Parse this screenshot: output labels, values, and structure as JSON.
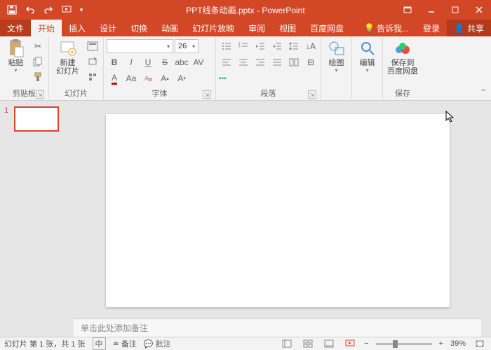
{
  "title": "PPT线条动画.pptx - PowerPoint",
  "qat": {
    "save": "保存",
    "undo": "撤销",
    "redo": "重做",
    "start": "从头开始"
  },
  "tabs": {
    "file": "文件",
    "home": "开始",
    "insert": "插入",
    "design": "设计",
    "transitions": "切换",
    "animations": "动画",
    "slideshow": "幻灯片放映",
    "review": "审阅",
    "view": "视图",
    "baidu": "百度网盘",
    "tell_me": "告诉我...",
    "login": "登录",
    "share": "共享"
  },
  "ribbon": {
    "clipboard": {
      "label": "剪贴板",
      "paste": "粘贴"
    },
    "slides": {
      "label": "幻灯片",
      "new_slide": "新建\n幻灯片"
    },
    "font": {
      "label": "字体",
      "size": "26"
    },
    "paragraph": {
      "label": "段落"
    },
    "drawing": {
      "label": "绘图",
      "btn": "绘图"
    },
    "editing": {
      "label": "编辑",
      "btn": "编辑"
    },
    "save": {
      "label": "保存",
      "btn": "保存到\n百度网盘"
    }
  },
  "slide_number": "1",
  "notes_placeholder": "单击此处添加备注",
  "status": {
    "slide_info": "幻灯片 第 1 张，共 1 张",
    "lang": "中",
    "notes": "备注",
    "comments": "批注",
    "zoom": "39%"
  }
}
